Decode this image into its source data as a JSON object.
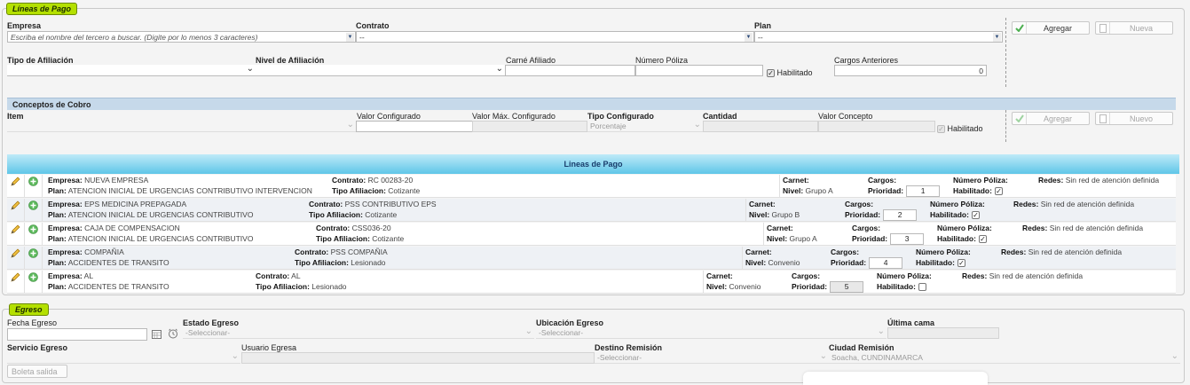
{
  "lineas_pago": {
    "legend": "Líneas de Pago",
    "empresa_label": "Empresa",
    "empresa_placeholder": "Escriba el nombre del tercero a buscar. (Digite por lo menos 3 caracteres)",
    "contrato_label": "Contrato",
    "contrato_value": "--",
    "plan_label": "Plan",
    "plan_value": "--",
    "agregar_label": "Agregar",
    "nueva_label": "Nueva",
    "tipo_afiliacion_label": "Tipo de Afiliación",
    "nivel_afiliacion_label": "Nivel de Afiliación",
    "carne_label": "Carné Afiliado",
    "numero_poliza_label": "Número Póliza",
    "habilitado_label": "Habilitado",
    "cargos_anteriores_label": "Cargos Anteriores",
    "cargos_anteriores_value": "0"
  },
  "conceptos": {
    "title": "Conceptos de Cobro",
    "item_label": "Item",
    "valor_configurado_label": "Valor Configurado",
    "valor_max_label": "Valor Máx. Configurado",
    "tipo_configurado_label": "Tipo Configurado",
    "tipo_configurado_value": "Porcentaje",
    "cantidad_label": "Cantidad",
    "valor_concepto_label": "Valor Concepto",
    "habilitado_label": "Habilitado",
    "agregar_label": "Agregar",
    "nuevo_label": "Nuevo"
  },
  "grid": {
    "title": "Lineas de Pago",
    "keys": {
      "empresa": "Empresa:",
      "plan": "Plan:",
      "contrato": "Contrato:",
      "tipo_afiliacion": "Tipo Afiliacion:",
      "carnet": "Carnet:",
      "nivel": "Nivel:",
      "cargos": "Cargos:",
      "prioridad": "Prioridad:",
      "numero_poliza": "Número Póliza:",
      "habilitado": "Habilitado:",
      "redes": "Redes:"
    },
    "rows": [
      {
        "empresa": "NUEVA EMPRESA",
        "plan": "ATENCION INICIAL DE URGENCIAS CONTRIBUTIVO INTERVENCION",
        "contrato": "RC 00283-20",
        "tipo_afiliacion": "Cotizante",
        "nivel": "Grupo A",
        "prioridad": "1",
        "habilitado": true,
        "redes": "Sin red de atención definida"
      },
      {
        "empresa": "EPS MEDICINA PREPAGADA",
        "plan": "ATENCION INICIAL DE URGENCIAS CONTRIBUTIVO",
        "contrato": "PSS CONTRIBUTIVO EPS",
        "tipo_afiliacion": "Cotizante",
        "nivel": "Grupo B",
        "prioridad": "2",
        "habilitado": true,
        "redes": "Sin red de atención definida"
      },
      {
        "empresa": "CAJA DE COMPENSACION",
        "plan": "ATENCION INICIAL DE URGENCIAS CONTRIBUTIVO",
        "contrato": "CSS036-20",
        "tipo_afiliacion": "Cotizante",
        "nivel": "Grupo A",
        "prioridad": "3",
        "habilitado": true,
        "redes": "Sin red de atención definida"
      },
      {
        "empresa": "COMPAÑIA",
        "plan": "ACCIDENTES DE TRANSITO",
        "contrato": "PSS COMPAÑIA",
        "tipo_afiliacion": "Lesionado",
        "nivel": "Convenio",
        "prioridad": "4",
        "habilitado": true,
        "redes": "Sin red de atención definida"
      },
      {
        "empresa": "AL",
        "plan": "ACCIDENTES DE TRANSITO",
        "contrato": "AL",
        "tipo_afiliacion": "Lesionado",
        "nivel": "Convenio",
        "prioridad": "5",
        "habilitado": false,
        "redes": "Sin red de atención definida"
      }
    ]
  },
  "egreso": {
    "legend": "Egreso",
    "fecha_label": "Fecha Egreso",
    "estado_label": "Estado Egreso",
    "estado_value": "-Seleccionar-",
    "ubicacion_label": "Ubicación Egreso",
    "ubicacion_value": "-Seleccionar-",
    "ultima_cama_label": "Última cama",
    "servicio_label": "Servicio Egreso",
    "usuario_label": "Usuario Egresa",
    "destino_label": "Destino Remisión",
    "destino_value": "-Seleccionar-",
    "ciudad_label": "Ciudad Remisión",
    "ciudad_value": "Soacha, CUNDINAMARCA",
    "boleta_label": "Boleta salida"
  },
  "colors": {
    "legend": "#b4e000",
    "grid_header": "#5fc6e8",
    "section_bar": "#c6d9ea",
    "check_green": "#4caf50"
  }
}
